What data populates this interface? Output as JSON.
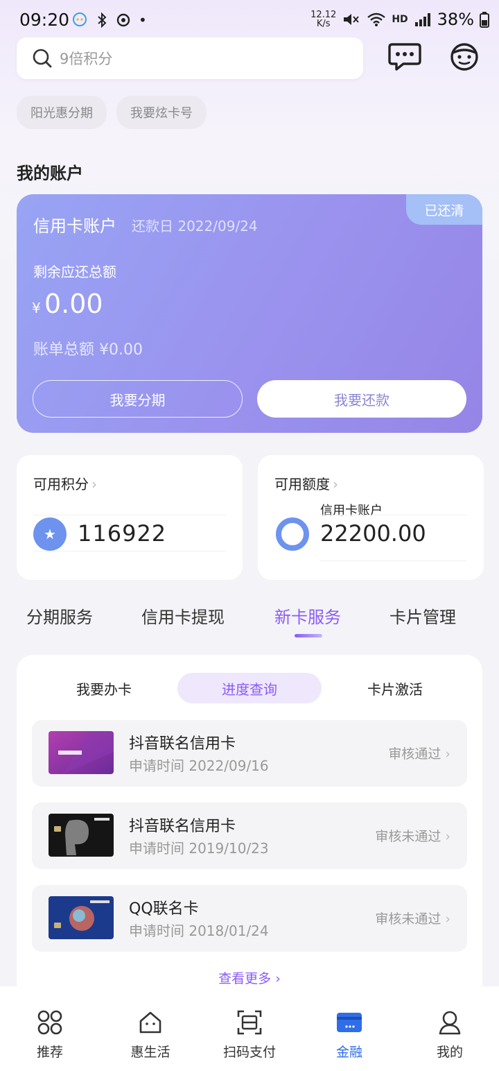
{
  "status_bar": {
    "time": "09:20",
    "speed": "12.12",
    "speed_unit": "K/s",
    "battery": "38%",
    "network": "HD"
  },
  "search": {
    "placeholder": "9倍积分"
  },
  "chips": [
    "阳光惠分期",
    "我要炫卡号"
  ],
  "section_title": "我的账户",
  "credit_account": {
    "title": "信用卡账户",
    "due_day": "还款日 2022/09/24",
    "status": "已还清",
    "remaining_label": "剩余应还总额",
    "currency": "¥",
    "remaining_amount": "0.00",
    "statement_total": "账单总额  ¥0.00",
    "installment_button": "我要分期",
    "repay_button": "我要还款"
  },
  "points": {
    "title": "可用积分",
    "value": "116922"
  },
  "limit": {
    "title": "可用额度",
    "sub_label": "信用卡账户",
    "value": "22200.00"
  },
  "tabs": [
    {
      "label": "分期服务"
    },
    {
      "label": "信用卡提现"
    },
    {
      "label": "新卡服务"
    },
    {
      "label": "卡片管理"
    }
  ],
  "subtabs": [
    {
      "label": "我要办卡"
    },
    {
      "label": "进度查询"
    },
    {
      "label": "卡片激活"
    }
  ],
  "applications": [
    {
      "name": "抖音联名信用卡",
      "time": "申请时间 2022/09/16",
      "status": "审核通过"
    },
    {
      "name": "抖音联名信用卡",
      "time": "申请时间 2019/10/23",
      "status": "审核未通过"
    },
    {
      "name": "QQ联名卡",
      "time": "申请时间 2018/01/24",
      "status": "审核未通过"
    }
  ],
  "see_more": "查看更多",
  "bottom_nav": [
    {
      "label": "推荐"
    },
    {
      "label": "惠生活"
    },
    {
      "label": "扫码支付"
    },
    {
      "label": "金融"
    },
    {
      "label": "我的"
    }
  ],
  "colors": {
    "accent": "#8b5cf6",
    "nav_active": "#2f6ee8",
    "card_gradient_start": "#98a4f4",
    "card_gradient_end": "#9585e6"
  }
}
